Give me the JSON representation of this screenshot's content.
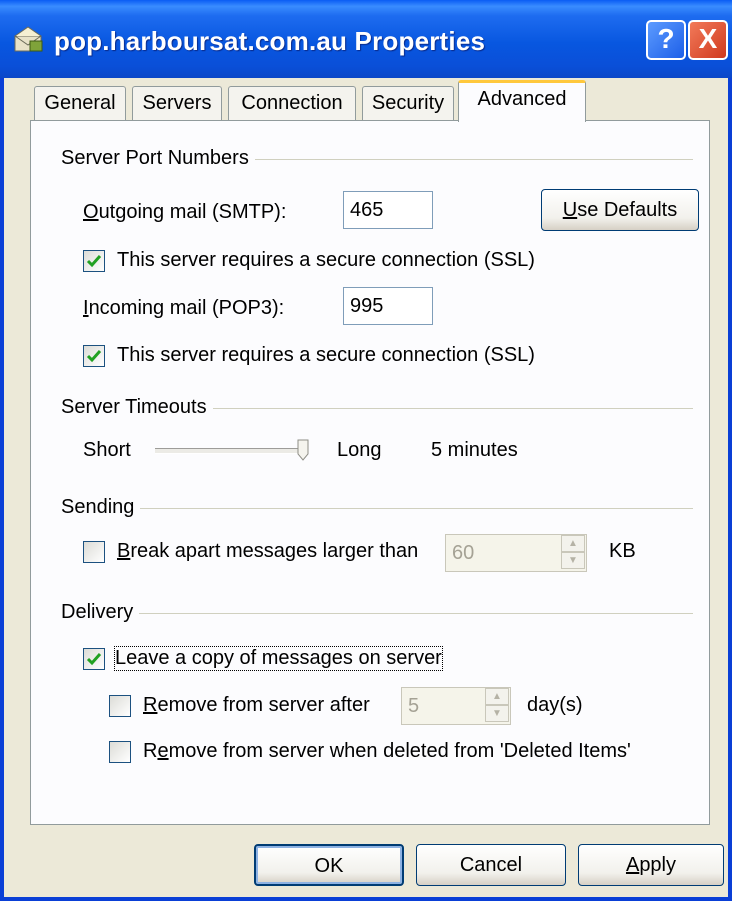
{
  "window": {
    "title": "pop.harboursat.com.au Properties",
    "help": "?",
    "close": "X"
  },
  "tabs": [
    {
      "label": "General"
    },
    {
      "label": "Servers"
    },
    {
      "label": "Connection"
    },
    {
      "label": "Security"
    },
    {
      "label": "Advanced",
      "active": true
    }
  ],
  "ports": {
    "group_label": "Server Port Numbers",
    "smtp_label": "Outgoing mail (SMTP):",
    "smtp_value": "465",
    "use_defaults": "Use Defaults",
    "smtp_ssl_label": "This server requires a secure connection (SSL)",
    "smtp_ssl_checked": true,
    "pop3_label": "Incoming mail (POP3):",
    "pop3_value": "995",
    "pop3_ssl_label": "This server requires a secure connection (SSL)",
    "pop3_ssl_checked": true
  },
  "timeouts": {
    "group_label": "Server Timeouts",
    "short_label": "Short",
    "long_label": "Long",
    "value_text": "5 minutes"
  },
  "sending": {
    "group_label": "Sending",
    "break_label": "Break apart messages larger than",
    "break_checked": false,
    "break_value": "60",
    "unit": "KB"
  },
  "delivery": {
    "group_label": "Delivery",
    "leave_copy_label": "Leave a copy of messages on server",
    "leave_copy_checked": true,
    "remove_after_label": "Remove from server after",
    "remove_after_checked": false,
    "remove_after_value": "5",
    "days_unit": "day(s)",
    "remove_deleted_label": "Remove from server when deleted from 'Deleted Items'",
    "remove_deleted_checked": false
  },
  "buttons": {
    "ok": "OK",
    "cancel": "Cancel",
    "apply": "Apply"
  },
  "colors": {
    "title_bar": "#0A5CF4",
    "dialog_bg": "#ECE9D8",
    "tab_highlight": "#FFC83C",
    "check_green": "#21A121"
  }
}
